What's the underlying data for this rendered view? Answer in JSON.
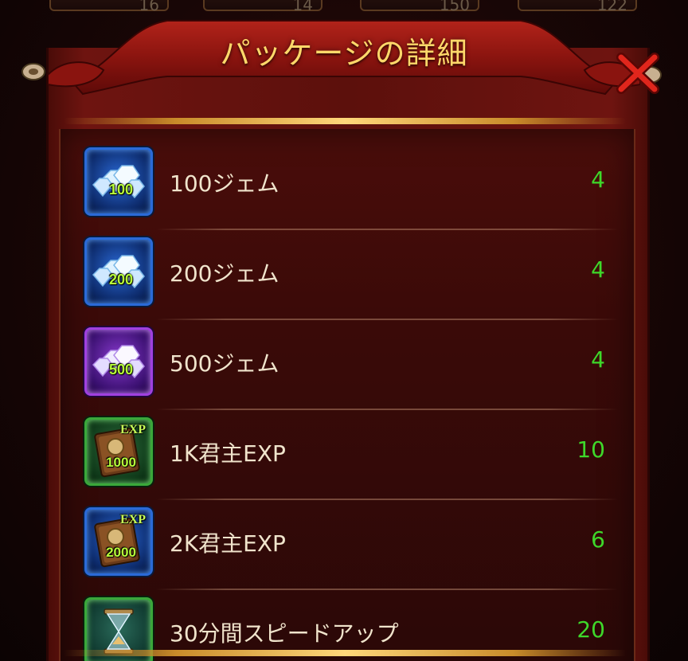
{
  "dialog": {
    "title": "パッケージの詳細",
    "close_icon": "close-x-icon"
  },
  "background_slots": [
    "16",
    "14",
    "150",
    "122"
  ],
  "items": [
    {
      "name": "100ジェム",
      "quantity": "4",
      "icon": "gem-icon",
      "icon_label": "100",
      "frame": "blue"
    },
    {
      "name": "200ジェム",
      "quantity": "4",
      "icon": "gem-icon",
      "icon_label": "200",
      "frame": "blue"
    },
    {
      "name": "500ジェム",
      "quantity": "4",
      "icon": "gem-icon",
      "icon_label": "500",
      "frame": "purple"
    },
    {
      "name": "1K君主EXP",
      "quantity": "10",
      "icon": "exp-book-icon",
      "icon_label": "1000",
      "icon_tag": "EXP",
      "frame": "green"
    },
    {
      "name": "2K君主EXP",
      "quantity": "6",
      "icon": "exp-book-icon",
      "icon_label": "2000",
      "icon_tag": "EXP",
      "frame": "blue"
    },
    {
      "name": "30分間スピードアップ",
      "quantity": "20",
      "icon": "hourglass-icon",
      "frame": "green"
    }
  ],
  "colors": {
    "title": "#ffd86a",
    "quantity": "#3ed82a",
    "item_name": "#f0e4cc",
    "frame_blue": "#2a6ad8",
    "frame_purple": "#a040e0",
    "frame_green": "#3aa83a"
  }
}
